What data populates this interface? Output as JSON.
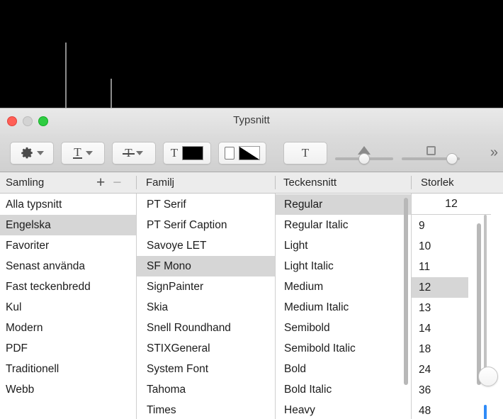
{
  "window": {
    "title": "Typsnitt",
    "traffic_lights": [
      "close-red",
      "minimize-gray",
      "zoom-green"
    ]
  },
  "toolbar": {
    "gear_button": {
      "icon": "gear-icon",
      "chevron": "chevron-down-icon"
    },
    "underline_button": {
      "icon": "underline-text-icon",
      "chevron": "chevron-down-icon"
    },
    "strikethrough_button": {
      "icon": "strikethrough-text-icon",
      "chevron": "chevron-down-icon"
    },
    "text_color_button": {
      "icon": "text-color-icon",
      "swatch": "#000000"
    },
    "document_color_button": {
      "icon": "document-color-icon",
      "swatch": "#000000"
    },
    "shadow_button": {
      "icon": "text-shadow-icon"
    },
    "shadow_blur_slider": {
      "icon": "triangle-icon",
      "value_pct": 48
    },
    "shadow_offset_slider": {
      "icon": "square-icon",
      "value_pct": 86
    },
    "overflow_button": {
      "label": "»"
    }
  },
  "columns": {
    "collection": {
      "header": "Samling",
      "add_label": "+",
      "remove_label": "−",
      "items": [
        "Alla typsnitt",
        "Engelska",
        "Favoriter",
        "Senast använda",
        "Fast teckenbredd",
        "Kul",
        "Modern",
        "PDF",
        "Traditionell",
        "Webb"
      ],
      "selected": "Engelska"
    },
    "family": {
      "header": "Familj",
      "items": [
        "PT Serif",
        "PT Serif Caption",
        "Savoye LET",
        "SF Mono",
        "SignPainter",
        "Skia",
        "Snell Roundhand",
        "STIXGeneral",
        "System Font",
        "Tahoma",
        "Times"
      ],
      "selected": "SF Mono"
    },
    "typeface": {
      "header": "Teckensnitt",
      "items": [
        "Regular",
        "Regular Italic",
        "Light",
        "Light Italic",
        "Medium",
        "Medium Italic",
        "Semibold",
        "Semibold Italic",
        "Bold",
        "Bold Italic",
        "Heavy"
      ],
      "selected": "Regular"
    },
    "size": {
      "header": "Storlek",
      "field_value": "12",
      "items": [
        "9",
        "10",
        "11",
        "12",
        "13",
        "14",
        "18",
        "24",
        "36",
        "48"
      ],
      "selected": "12",
      "slider_accent": "#2f8bf7"
    }
  },
  "callouts": [
    {
      "name": "gear-button-callout"
    },
    {
      "name": "add-remove-collection-callout"
    }
  ]
}
